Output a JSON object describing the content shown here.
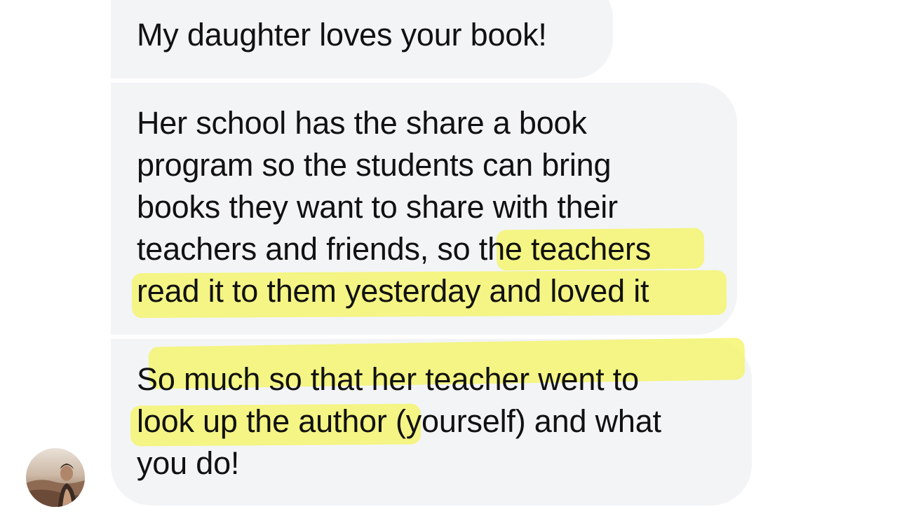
{
  "conversation": {
    "messages": [
      {
        "lines": [
          "My daughter loves your book!"
        ]
      },
      {
        "lines": [
          "Her school has the share a book",
          "program so the students can bring",
          "books they want to share with their",
          "teachers and friends, so the teachers",
          "read it to them yesterday and loved it"
        ]
      },
      {
        "lines": [
          "So much so that her teacher went to",
          "look up the author (yourself) and what",
          "you do!"
        ]
      }
    ],
    "highlighted_phrases": [
      "the teachers read it to them yesterday and loved it",
      "So much so that her teacher went to look up the author"
    ],
    "avatar": {
      "icon": "user-photo-avatar"
    }
  },
  "colors": {
    "bubble_background": "#f3f4f6",
    "highlight": "#f4f56a",
    "text": "#111111",
    "page_background": "#ffffff"
  }
}
